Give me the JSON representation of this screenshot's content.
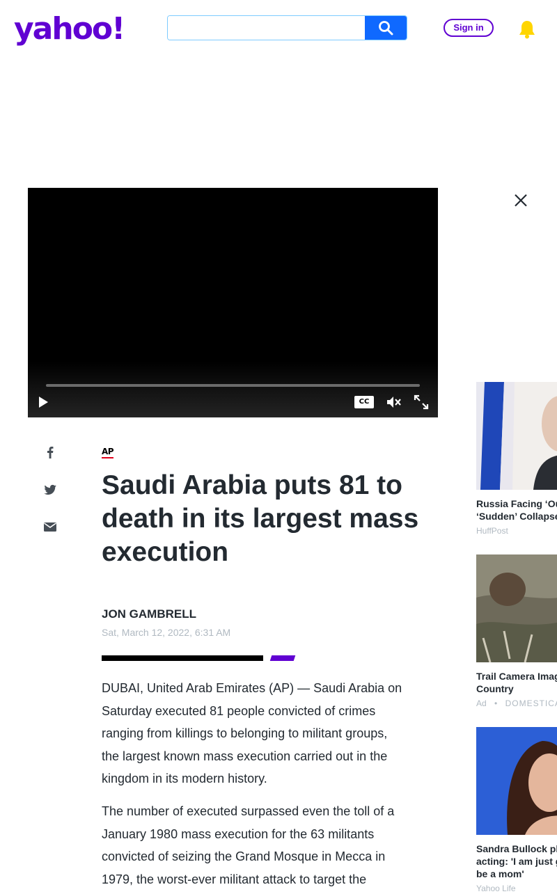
{
  "header": {
    "logo_text": "yahoo!",
    "search_placeholder": "",
    "signin_label": "Sign in",
    "brand_color": "#6001d2",
    "search_button_color": "#0f69ff",
    "icons": [
      "search-icon",
      "bell-icon"
    ]
  },
  "video": {
    "cc_label": "CC",
    "progress": 0,
    "controls": [
      "play-icon",
      "cc-icon",
      "mute-icon",
      "fullscreen-icon"
    ]
  },
  "share": {
    "icons": [
      "facebook-icon",
      "twitter-icon",
      "mail-icon"
    ]
  },
  "article": {
    "source": "AP",
    "headline": "Saudi Arabia puts 81 to death in its largest mass execution",
    "author": "JON GAMBRELL",
    "date": "Sat, March 12, 2022, 6:31 AM",
    "paragraphs": [
      "DUBAI, United Arab Emirates (AP) — Saudi Arabia on Saturday executed 81 people convicted of crimes ranging from killings to belonging to militant groups, the largest known mass execution carried out in the kingdom in its modern history.",
      "The number of executed surpassed even the toll of a January 1980 mass execution for the 63 militants convicted of seizing the Grand Mosque in Mecca in 1979, the worst-ever militant attack to target the"
    ]
  },
  "rail": {
    "items": [
      {
        "title": "Russia Facing ‘Ou\n‘Sudden’ Collapse",
        "source": "HuffPost",
        "ad": ""
      },
      {
        "title": "Trail Camera Imag\nCountry",
        "source": "DOMESTICA",
        "ad": "Ad"
      },
      {
        "title": "Sandra Bullock pl\nacting: 'I am just g\nbe a mom'",
        "source": "Yahoo Life",
        "ad": ""
      }
    ]
  }
}
